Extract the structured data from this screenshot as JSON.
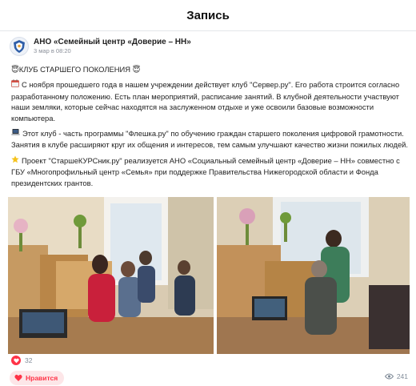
{
  "topbar": {
    "title": "Запись"
  },
  "post": {
    "author": "АНО «Семейный центр «Доверие – НН»",
    "date": "3 мар в 08:20",
    "headline": "КЛУБ СТАРШЕГО ПОКОЛЕНИЯ",
    "headline_emoji": "😇",
    "paragraphs": [
      {
        "icon": "calendar-emoji",
        "text": "С ноября прошедшего года в нашем учреждении действует клуб \"Сервер.ру\". Его работа строится согласно разработанному положению. Есть план мероприятий, расписание занятий. В клубной деятельности участвуют наши земляки, которые сейчас находятся на заслуженном отдыхе и уже освоили базовые возможности компьютера."
      },
      {
        "icon": "laptop-emoji",
        "text": "Этот клуб - часть программы \"Флешка.ру\" по обучению граждан старшего поколения цифровой грамотности. Занятия в клубе расширяют круг их общения и интересов, тем самым улучшают качество жизни пожилых людей."
      },
      {
        "icon": "star-emoji",
        "text": "Проект \"СтаршеКУРСник.ру\" реализуется АНО «Социальный семейный центр «Доверие – НН» совместно с ГБУ «Многопрофильный центр «Семья» при поддержке Правительства Нижегородской области и Фонда президентских грантов."
      }
    ]
  },
  "reactions": {
    "likes": "32",
    "like_label": "Нравится",
    "views": "241"
  },
  "colors": {
    "like_red": "#ff3347",
    "muted": "#818c99"
  }
}
